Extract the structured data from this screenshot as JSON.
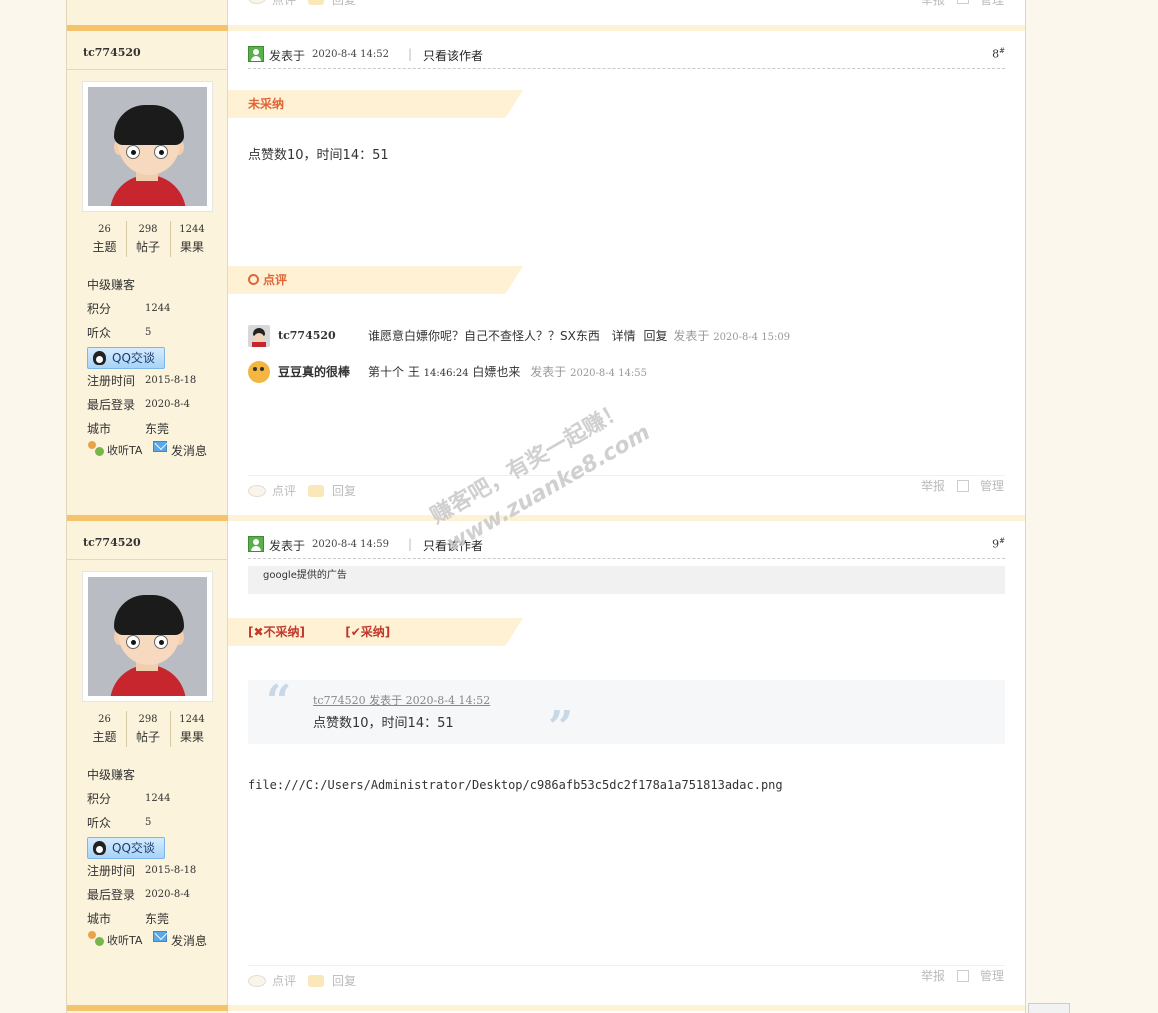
{
  "prev_footer": {
    "comment": "点评",
    "reply": "回复",
    "report": "举报",
    "manage": "管理"
  },
  "posts": [
    {
      "author": "tc774520",
      "stats": [
        {
          "num": "26",
          "label": "主题"
        },
        {
          "num": "298",
          "label": "帖子"
        },
        {
          "num": "1244",
          "label": "果果"
        }
      ],
      "level": "中级赚客",
      "points_label": "积分",
      "points": "1244",
      "listeners_label": "听众",
      "listeners": "5",
      "qq_label": "QQ交谈",
      "reg_label": "注册时间",
      "reg": "2015-8-18",
      "last_label": "最后登录",
      "last": "2020-8-4",
      "city_label": "城市",
      "city": "东莞",
      "follow": "收听TA",
      "message": "发消息",
      "posted_prefix": "发表于",
      "posted_time": "2020-8-4 14:52",
      "only_author": "只看该作者",
      "floor": "8",
      "floor_sup": "#",
      "status_banner": "未采纳",
      "body": "点赞数10，时间14：51",
      "comments_banner": "点评",
      "comments": [
        {
          "name": "tc774520",
          "text": "谁愿意白嫖你呢？自己不查怪人？？SX东西",
          "detail": "详情",
          "reply": "回复",
          "posted": "发表于",
          "time": "2020-8-4 15:09"
        },
        {
          "name": "豆豆真的很棒",
          "text": "第十个 王",
          "time_inline": "14:46:24",
          "text2": "白嫖也来",
          "posted": "发表于",
          "time": "2020-8-4 14:55"
        }
      ],
      "footer": {
        "comment": "点评",
        "reply": "回复",
        "report": "举报",
        "manage": "管理"
      }
    },
    {
      "author": "tc774520",
      "stats": [
        {
          "num": "26",
          "label": "主题"
        },
        {
          "num": "298",
          "label": "帖子"
        },
        {
          "num": "1244",
          "label": "果果"
        }
      ],
      "level": "中级赚客",
      "points_label": "积分",
      "points": "1244",
      "listeners_label": "听众",
      "listeners": "5",
      "qq_label": "QQ交谈",
      "reg_label": "注册时间",
      "reg": "2015-8-18",
      "last_label": "最后登录",
      "last": "2020-8-4",
      "city_label": "城市",
      "city": "东莞",
      "follow": "收听TA",
      "message": "发消息",
      "posted_prefix": "发表于",
      "posted_time": "2020-8-4 14:59",
      "only_author": "只看该作者",
      "floor": "9",
      "floor_sup": "#",
      "ad": "google提供的广告",
      "reject": "[✖不采纳]",
      "accept": "[✔采纳]",
      "quote_author": "tc774520 发表于 2020-8-4 14:52",
      "quote_text": "点赞数10，时间14：51",
      "file_path": "file:///C:/Users/Administrator/Desktop/c986afb53c5dc2f178a1a751813adac.png",
      "footer": {
        "comment": "点评",
        "reply": "回复",
        "report": "举报",
        "manage": "管理"
      }
    }
  ],
  "watermark_line1": "赚客吧，有奖一起赚！",
  "watermark_line2": "www.zuanke8.com"
}
